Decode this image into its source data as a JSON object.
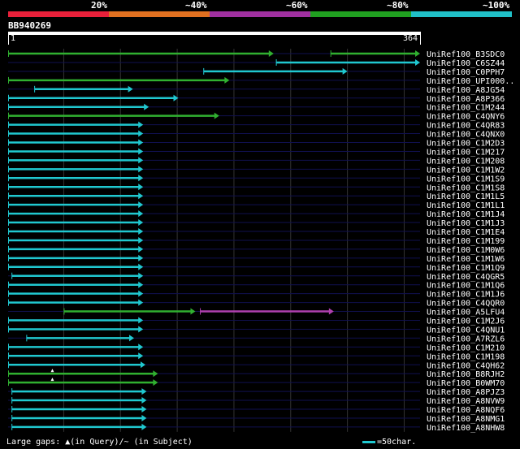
{
  "legend": {
    "labels": [
      "20%",
      "~40%",
      "~60%",
      "~80%",
      "~100%"
    ],
    "colors": [
      "#e8203a",
      "#e07020",
      "#a030a0",
      "#20a020",
      "#20c0c8"
    ]
  },
  "query": {
    "name": "BB940269",
    "start_label": "1",
    "end_label": "364"
  },
  "colors": {
    "cyan": "#20c8d0",
    "green": "#30b030",
    "magenta": "#b040b0",
    "grid": "#333333",
    "row_line": "#101050"
  },
  "chart_data": {
    "type": "bar",
    "query_length": 364,
    "grid_step": 50,
    "hits": [
      {
        "name": "UniRef100_B3SDC0",
        "segments": [
          {
            "start": 1,
            "end": 235,
            "color": "green"
          },
          {
            "start": 285,
            "end": 364,
            "color": "green"
          }
        ]
      },
      {
        "name": "UniRef100_C6SZ44",
        "segments": [
          {
            "start": 237,
            "end": 364,
            "color": "cyan"
          }
        ]
      },
      {
        "name": "UniRef100_C0PPH7",
        "segments": [
          {
            "start": 173,
            "end": 300,
            "color": "cyan"
          }
        ]
      },
      {
        "name": "UniRef100_UPI000..",
        "segments": [
          {
            "start": 1,
            "end": 196,
            "color": "green"
          }
        ]
      },
      {
        "name": "UniRef100_A8JG54",
        "segments": [
          {
            "start": 24,
            "end": 111,
            "color": "cyan"
          }
        ]
      },
      {
        "name": "UniRef100_A8P366",
        "segments": [
          {
            "start": 1,
            "end": 151,
            "color": "cyan"
          }
        ]
      },
      {
        "name": "UniRef100_C1M244",
        "segments": [
          {
            "start": 1,
            "end": 125,
            "color": "cyan"
          }
        ]
      },
      {
        "name": "UniRef100_C4QNY6",
        "segments": [
          {
            "start": 1,
            "end": 187,
            "color": "green"
          }
        ]
      },
      {
        "name": "UniRef100_C4QR83",
        "segments": [
          {
            "start": 1,
            "end": 120,
            "color": "cyan"
          }
        ]
      },
      {
        "name": "UniRef100_C4QNX0",
        "segments": [
          {
            "start": 1,
            "end": 120,
            "color": "cyan"
          }
        ]
      },
      {
        "name": "UniRef100_C1M2D3",
        "segments": [
          {
            "start": 1,
            "end": 120,
            "color": "cyan"
          }
        ]
      },
      {
        "name": "UniRef100_C1M217",
        "segments": [
          {
            "start": 1,
            "end": 120,
            "color": "cyan"
          }
        ]
      },
      {
        "name": "UniRef100_C1M208",
        "segments": [
          {
            "start": 1,
            "end": 120,
            "color": "cyan"
          }
        ]
      },
      {
        "name": "UniRef100_C1M1W2",
        "segments": [
          {
            "start": 1,
            "end": 120,
            "color": "cyan"
          }
        ]
      },
      {
        "name": "UniRef100_C1M1S9",
        "segments": [
          {
            "start": 1,
            "end": 120,
            "color": "cyan"
          }
        ]
      },
      {
        "name": "UniRef100_C1M1S8",
        "segments": [
          {
            "start": 1,
            "end": 120,
            "color": "cyan"
          }
        ]
      },
      {
        "name": "UniRef100_C1M1L5",
        "segments": [
          {
            "start": 1,
            "end": 120,
            "color": "cyan"
          }
        ]
      },
      {
        "name": "UniRef100_C1M1L1",
        "segments": [
          {
            "start": 1,
            "end": 120,
            "color": "cyan"
          }
        ]
      },
      {
        "name": "UniRef100_C1M1J4",
        "segments": [
          {
            "start": 1,
            "end": 120,
            "color": "cyan"
          }
        ]
      },
      {
        "name": "UniRef100_C1M1J3",
        "segments": [
          {
            "start": 1,
            "end": 120,
            "color": "cyan"
          }
        ]
      },
      {
        "name": "UniRef100_C1M1E4",
        "segments": [
          {
            "start": 1,
            "end": 120,
            "color": "cyan"
          }
        ]
      },
      {
        "name": "UniRef100_C1M199",
        "segments": [
          {
            "start": 1,
            "end": 120,
            "color": "cyan"
          }
        ]
      },
      {
        "name": "UniRef100_C1M0W6",
        "segments": [
          {
            "start": 1,
            "end": 120,
            "color": "cyan"
          }
        ]
      },
      {
        "name": "UniRef100_C1M1W6",
        "segments": [
          {
            "start": 1,
            "end": 120,
            "color": "cyan"
          }
        ]
      },
      {
        "name": "UniRef100_C1M1Q9",
        "segments": [
          {
            "start": 1,
            "end": 120,
            "color": "cyan"
          }
        ]
      },
      {
        "name": "UniRef100_C4QGR5",
        "segments": [
          {
            "start": 4,
            "end": 120,
            "color": "cyan"
          }
        ]
      },
      {
        "name": "UniRef100_C1M1Q6",
        "segments": [
          {
            "start": 1,
            "end": 120,
            "color": "cyan"
          }
        ]
      },
      {
        "name": "UniRef100_C1M1J6",
        "segments": [
          {
            "start": 1,
            "end": 120,
            "color": "cyan"
          }
        ]
      },
      {
        "name": "UniRef100_C4QQR0",
        "segments": [
          {
            "start": 1,
            "end": 120,
            "color": "cyan"
          }
        ]
      },
      {
        "name": "UniRef100_A5LFU4",
        "segments": [
          {
            "start": 50,
            "end": 166,
            "color": "green"
          },
          {
            "start": 170,
            "end": 288,
            "color": "magenta"
          }
        ]
      },
      {
        "name": "UniRef100_C1M2J6",
        "segments": [
          {
            "start": 1,
            "end": 120,
            "color": "cyan"
          }
        ]
      },
      {
        "name": "UniRef100_C4QNU1",
        "segments": [
          {
            "start": 1,
            "end": 120,
            "color": "cyan"
          }
        ]
      },
      {
        "name": "UniRef100_A7RZL6",
        "segments": [
          {
            "start": 17,
            "end": 112,
            "color": "cyan"
          }
        ]
      },
      {
        "name": "UniRef100_C1M210",
        "segments": [
          {
            "start": 1,
            "end": 120,
            "color": "cyan"
          }
        ]
      },
      {
        "name": "UniRef100_C1M198",
        "segments": [
          {
            "start": 1,
            "end": 120,
            "color": "cyan"
          }
        ]
      },
      {
        "name": "UniRef100_C4QH62",
        "segments": [
          {
            "start": 1,
            "end": 122,
            "color": "cyan"
          }
        ]
      },
      {
        "name": "UniRef100_B8RJH2",
        "segments": [
          {
            "start": 1,
            "end": 133,
            "color": "green"
          }
        ]
      },
      {
        "name": "UniRef100_B0WM70",
        "segments": [
          {
            "start": 1,
            "end": 133,
            "color": "green"
          }
        ]
      },
      {
        "name": "UniRef100_A8PJZ3",
        "segments": [
          {
            "start": 4,
            "end": 123,
            "color": "cyan"
          }
        ]
      },
      {
        "name": "UniRef100_A8NVW9",
        "segments": [
          {
            "start": 4,
            "end": 123,
            "color": "cyan"
          }
        ]
      },
      {
        "name": "UniRef100_A8NQF6",
        "segments": [
          {
            "start": 4,
            "end": 123,
            "color": "cyan"
          }
        ]
      },
      {
        "name": "UniRef100_A8NMG1",
        "segments": [
          {
            "start": 4,
            "end": 123,
            "color": "cyan"
          }
        ]
      },
      {
        "name": "UniRef100_A8NHW8",
        "segments": [
          {
            "start": 4,
            "end": 123,
            "color": "cyan"
          }
        ]
      }
    ],
    "gap_markers": [
      {
        "row": 36,
        "pos": 40
      },
      {
        "row": 37,
        "pos": 40
      }
    ]
  },
  "footer": {
    "gaps_note": "Large gaps: ▲(in Query)/~ (in Subject)",
    "scale_note": "=50char."
  }
}
